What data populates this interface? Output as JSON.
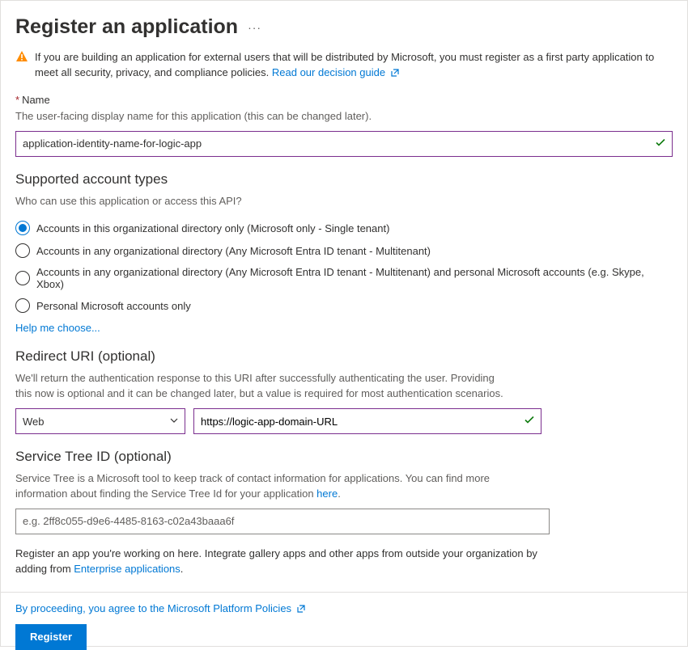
{
  "title": "Register an application",
  "warning": {
    "text": "If you are building an application for external users that will be distributed by Microsoft, you must register as a first party application to meet all security, privacy, and compliance policies. ",
    "link": "Read our decision guide"
  },
  "name_section": {
    "label": "Name",
    "help": "The user-facing display name for this application (this can be changed later).",
    "value": "application-identity-name-for-logic-app"
  },
  "account_types": {
    "heading": "Supported account types",
    "question": "Who can use this application or access this API?",
    "options": [
      "Accounts in this organizational directory only (Microsoft only - Single tenant)",
      "Accounts in any organizational directory (Any Microsoft Entra ID tenant - Multitenant)",
      "Accounts in any organizational directory (Any Microsoft Entra ID tenant - Multitenant) and personal Microsoft accounts (e.g. Skype, Xbox)",
      "Personal Microsoft accounts only"
    ],
    "selected_index": 0,
    "help_link": "Help me choose..."
  },
  "redirect": {
    "heading": "Redirect URI (optional)",
    "help_line1": "We'll return the authentication response to this URI after successfully authenticating the user. Providing",
    "help_line2": "this now is optional and it can be changed later, but a value is required for most authentication scenarios.",
    "platform": "Web",
    "uri_value": "https://logic-app-domain-URL"
  },
  "service_tree": {
    "heading": "Service Tree ID (optional)",
    "help_line1": "Service Tree is a Microsoft tool to keep track of contact information for applications. You can find more",
    "help_line2_pre": "information about finding the Service Tree Id for your application ",
    "help_link": "here",
    "placeholder": "e.g. 2ff8c055-d9e6-4485-8163-c02a43baaa6f"
  },
  "footer": {
    "text_pre": "Register an app you're working on here. Integrate gallery apps and other apps from outside your organization by adding from ",
    "link": "Enterprise applications"
  },
  "proceed": "By proceeding, you agree to the Microsoft Platform Policies",
  "register_button": "Register"
}
